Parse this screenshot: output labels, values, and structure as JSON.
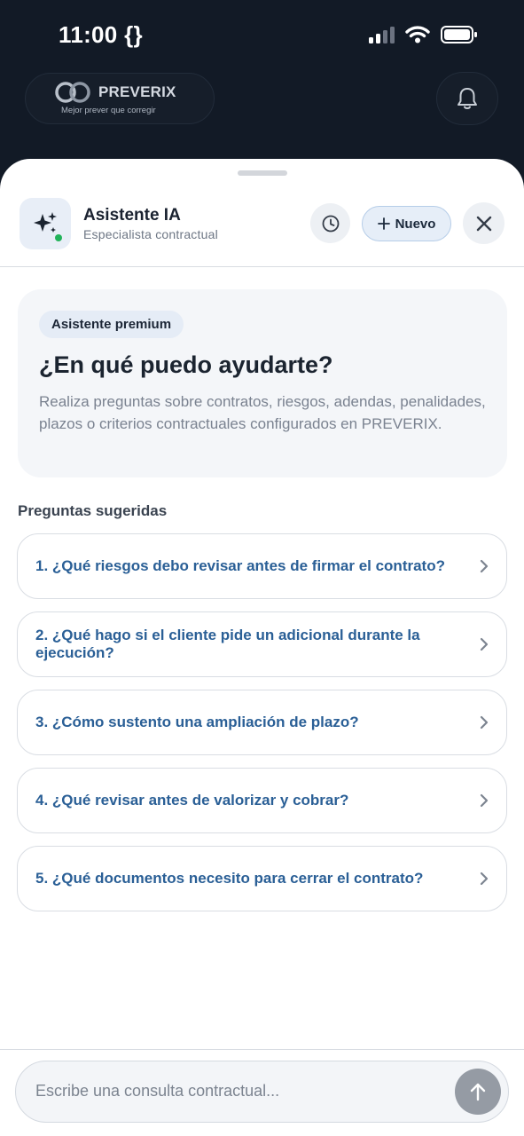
{
  "status_bar": {
    "time": "11:00 {}",
    "icons": [
      "cellular-signal-icon",
      "wifi-icon",
      "battery-icon"
    ]
  },
  "app_header": {
    "logo_name": "PREVERIX",
    "logo_tagline": "Mejor prever que corregir",
    "icons": [
      "preverix-logo-icon",
      "bell-icon"
    ]
  },
  "chat_header": {
    "assistant_name": "Asistente IA",
    "assistant_subtitle": "Especialista contractual",
    "new_label": "Nuevo",
    "icons": [
      "sparkles-icon",
      "history-clock-icon",
      "plus-icon",
      "close-icon"
    ]
  },
  "intro": {
    "badge": "Asistente premium",
    "title": "¿En qué puedo ayudarte?",
    "description": "Realiza preguntas sobre contratos, riesgos, adendas, penalidades, plazos o criterios contractuales configurados en PREVERIX."
  },
  "suggestions": {
    "title": "Preguntas sugeridas",
    "items": [
      "1. ¿Qué riesgos debo revisar antes de firmar el contrato?",
      "2. ¿Qué hago si el cliente pide un adicional durante la ejecución?",
      "3. ¿Cómo sustento una ampliación de plazo?",
      "4. ¿Qué revisar antes de valorizar y cobrar?",
      "5. ¿Qué documentos necesito para cerrar el contrato?"
    ]
  },
  "composer": {
    "placeholder": "Escribe una consulta contractual...",
    "value": "",
    "icons": [
      "send-arrow-up-icon"
    ]
  },
  "colors": {
    "header_bg": "#121a26",
    "accent_link": "#2a5f96",
    "online": "#22b35a",
    "send_disabled": "#959ba4"
  }
}
